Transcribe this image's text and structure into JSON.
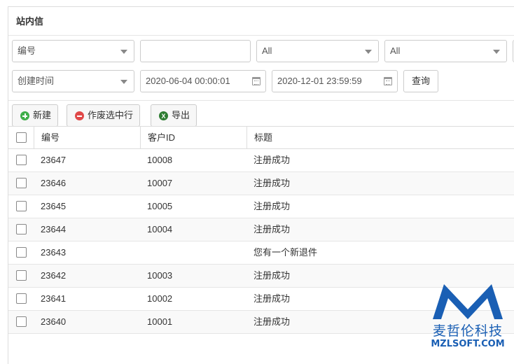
{
  "panel": {
    "title": "站内信"
  },
  "filters": {
    "row1": {
      "field_select": "编号",
      "text_value": "",
      "status_select_1": "All",
      "status_select_2": "All"
    },
    "row2": {
      "date_field_select": "创建时间",
      "date_from": "2020-06-04 00:00:01",
      "date_to": "2020-12-01 23:59:59",
      "search_label": "查询"
    }
  },
  "toolbar": {
    "new_label": "新建",
    "void_label": "作废选中行",
    "export_label": "导出"
  },
  "grid": {
    "columns": [
      "编号",
      "客户ID",
      "标题"
    ],
    "rows": [
      {
        "id": "23647",
        "customer_id": "10008",
        "title": "注册成功"
      },
      {
        "id": "23646",
        "customer_id": "10007",
        "title": "注册成功"
      },
      {
        "id": "23645",
        "customer_id": "10005",
        "title": "注册成功"
      },
      {
        "id": "23644",
        "customer_id": "10004",
        "title": "注册成功"
      },
      {
        "id": "23643",
        "customer_id": "",
        "title": "您有一个新退件"
      },
      {
        "id": "23642",
        "customer_id": "10003",
        "title": "注册成功"
      },
      {
        "id": "23641",
        "customer_id": "10002",
        "title": "注册成功"
      },
      {
        "id": "23640",
        "customer_id": "10001",
        "title": "注册成功"
      }
    ]
  },
  "watermark": {
    "brand": "麦哲伦科技",
    "url": "MZLSOFT.COM",
    "color": "#1a5fb4"
  }
}
